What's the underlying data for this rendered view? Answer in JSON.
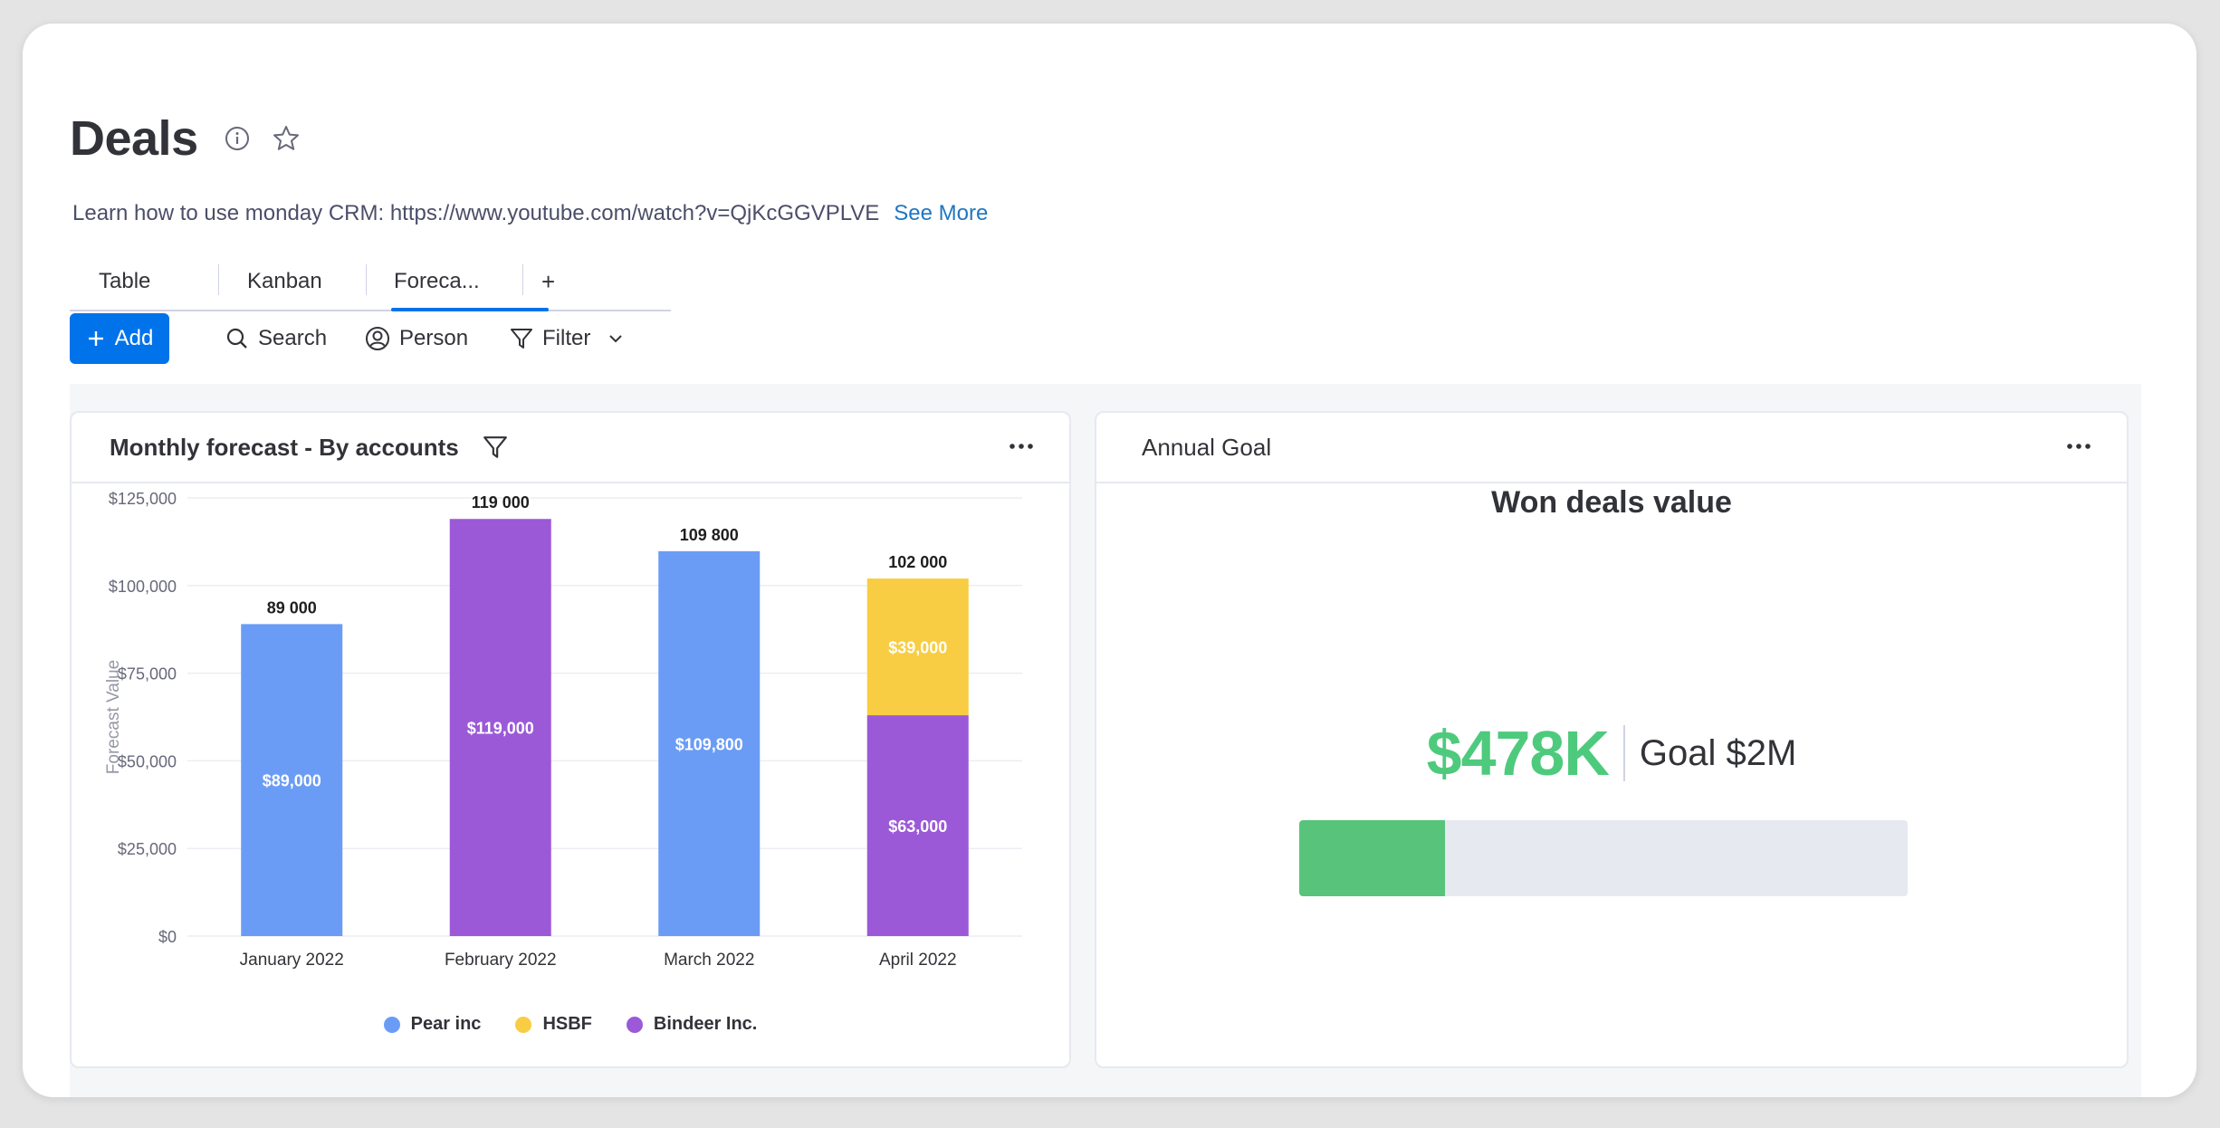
{
  "header": {
    "title": "Deals",
    "subtitle": "Learn how to use monday CRM: https://www.youtube.com/watch?v=QjKcGGVPLVE",
    "see_more": "See More"
  },
  "tabs": [
    {
      "label": "Table"
    },
    {
      "label": "Kanban"
    },
    {
      "label": "Foreca..."
    },
    {
      "label": "+"
    }
  ],
  "toolbar": {
    "add": "Add",
    "search": "Search",
    "person": "Person",
    "filter": "Filter"
  },
  "forecast_widget": {
    "title": "Monthly forecast - By accounts"
  },
  "goal_widget": {
    "title": "Annual Goal",
    "heading": "Won deals value",
    "value": "$478K",
    "goal": "Goal $2M",
    "progress": 0.239
  },
  "colors": {
    "accent": "#0073ea",
    "pear": "#6a9cf5",
    "hsbf": "#f8cd43",
    "bindeer": "#9b59d8",
    "goal_green": "#4eca7d"
  },
  "chart_data": {
    "type": "bar",
    "stacked": true,
    "categories": [
      "January 2022",
      "February 2022",
      "March 2022",
      "April 2022"
    ],
    "series": [
      {
        "name": "Pear inc",
        "color": "#6a9cf5",
        "values": [
          89000,
          0,
          109800,
          0
        ],
        "labels": [
          "$89,000",
          "",
          "$109,800",
          ""
        ]
      },
      {
        "name": "Bindeer Inc.",
        "color": "#9b59d8",
        "values": [
          0,
          119000,
          0,
          63000
        ],
        "labels": [
          "",
          "$119,000",
          "",
          "$63,000"
        ]
      },
      {
        "name": "HSBF",
        "color": "#f8cd43",
        "values": [
          0,
          0,
          0,
          39000
        ],
        "labels": [
          "",
          "",
          "",
          "$39,000"
        ]
      }
    ],
    "totals": [
      "89 000",
      "119 000",
      "109 800",
      "102 000"
    ],
    "legend_order": [
      "Pear inc",
      "HSBF",
      "Bindeer Inc."
    ],
    "ylabel": "Forecast Value",
    "yticks": [
      "$0",
      "$25,000",
      "$50,000",
      "$75,000",
      "$100,000",
      "$125,000"
    ],
    "ylim": [
      0,
      125000
    ],
    "grid": true,
    "legend_position": "bottom"
  }
}
